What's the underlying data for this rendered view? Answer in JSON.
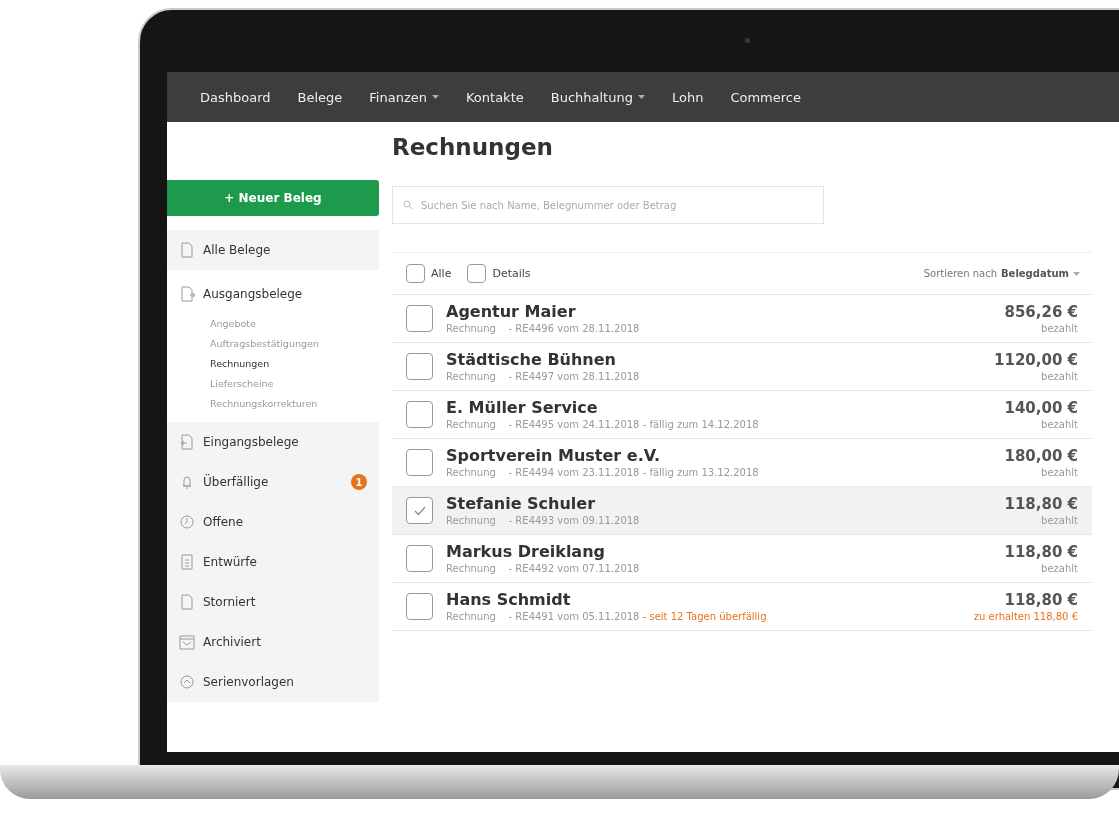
{
  "nav": {
    "items": [
      {
        "label": "Dashboard",
        "dropdown": false
      },
      {
        "label": "Belege",
        "dropdown": false
      },
      {
        "label": "Finanzen",
        "dropdown": true
      },
      {
        "label": "Kontakte",
        "dropdown": false
      },
      {
        "label": "Buchhaltung",
        "dropdown": true
      },
      {
        "label": "Lohn",
        "dropdown": false
      },
      {
        "label": "Commerce",
        "dropdown": false
      }
    ]
  },
  "sidebar": {
    "new_button": "+ Neuer Beleg",
    "items": [
      {
        "label": "Alle Belege",
        "expanded": false
      },
      {
        "label": "Ausgangsbelege",
        "expanded": true,
        "children": [
          {
            "label": "Angebote",
            "selected": false
          },
          {
            "label": "Auftragsbestätigungen",
            "selected": false
          },
          {
            "label": "Rechnungen",
            "selected": true
          },
          {
            "label": "Lieferscheine",
            "selected": false
          },
          {
            "label": "Rechnungskorrekturen",
            "selected": false
          }
        ]
      },
      {
        "label": "Eingangsbelege",
        "expanded": false
      },
      {
        "label": "Überfällige",
        "expanded": false,
        "badge": "1"
      },
      {
        "label": "Offene",
        "expanded": false
      },
      {
        "label": "Entwürfe",
        "expanded": false
      },
      {
        "label": "Storniert",
        "expanded": false
      },
      {
        "label": "Archiviert",
        "expanded": false
      },
      {
        "label": "Serienvorlagen",
        "expanded": false
      }
    ]
  },
  "main": {
    "title": "Rechnungen",
    "search": {
      "placeholder": "Suchen Sie nach Name, Belegnummer oder Betrag"
    },
    "filters": [
      {
        "label": "Alle",
        "checked": false
      },
      {
        "label": "Details",
        "checked": false
      }
    ],
    "sort": {
      "label": "Sortieren nach",
      "value": "Belegdatum"
    },
    "rows": [
      {
        "name": "Agentur Maier",
        "type": "Rechnung",
        "ref": "- RE4496 vom 28.11.2018",
        "amount": "856,26 €",
        "status": "bezahlt",
        "checked": false,
        "overdue": false
      },
      {
        "name": "Städtische Bühnen",
        "type": "Rechnung",
        "ref": "- RE4497 vom 28.11.2018",
        "amount": "1120,00 €",
        "status": "bezahlt",
        "checked": false,
        "overdue": false
      },
      {
        "name": "E. Müller Service",
        "type": "Rechnung",
        "ref": "- RE4495 vom 24.11.2018 - fällig zum 14.12.2018",
        "amount": "140,00 €",
        "status": "bezahlt",
        "checked": false,
        "overdue": false
      },
      {
        "name": "Sportverein Muster e.V.",
        "type": "Rechnung",
        "ref": "- RE4494 vom 23.11.2018 - fällig zum 13.12.2018",
        "amount": "180,00 €",
        "status": "bezahlt",
        "checked": false,
        "overdue": false
      },
      {
        "name": "Stefanie Schuler",
        "type": "Rechnung",
        "ref": "- RE4493 vom 09.11.2018",
        "amount": "118,80 €",
        "status": "bezahlt",
        "checked": true,
        "overdue": false
      },
      {
        "name": "Markus Dreiklang",
        "type": "Rechnung",
        "ref": "- RE4492 vom 07.11.2018",
        "amount": "118,80 €",
        "status": "bezahlt",
        "checked": false,
        "overdue": false
      },
      {
        "name": "Hans Schmidt",
        "type": "Rechnung",
        "ref": "- RE4491 vom 05.11.2018",
        "note": "- seit 12 Tagen überfällig",
        "amount": "118,80 €",
        "status": "zu erhalten 118,80 €",
        "checked": false,
        "overdue": true
      }
    ]
  }
}
